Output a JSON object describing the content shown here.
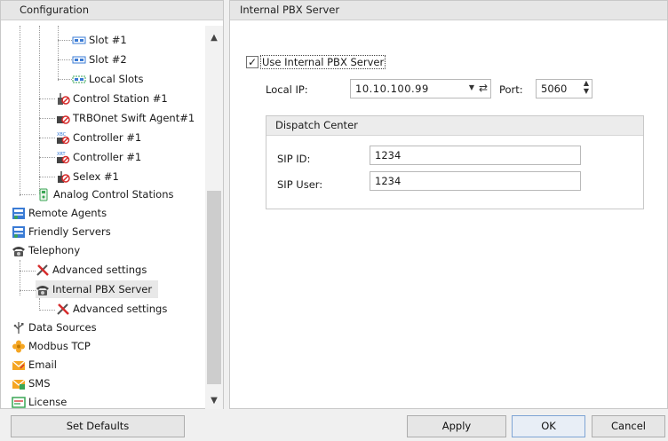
{
  "left_panel": {
    "header": "Configuration",
    "tree": {
      "slot1": "Slot #1",
      "slot2": "Slot #2",
      "local_slots": "Local Slots",
      "control_station": "Control Station #1",
      "trbonet_agent": "TRBOnet Swift Agent#1",
      "controller1": "Controller #1",
      "controller2": "Controller #1",
      "selex": "Selex #1",
      "analog_control": "Analog Control Stations",
      "remote_agents": "Remote Agents",
      "friendly_servers": "Friendly Servers",
      "telephony": "Telephony",
      "advanced_settings_1": "Advanced settings",
      "internal_pbx": "Internal PBX Server",
      "advanced_settings_2": "Advanced settings",
      "data_sources": "Data Sources",
      "modbus_tcp": "Modbus TCP",
      "email": "Email",
      "sms": "SMS",
      "license": "License"
    },
    "set_defaults": "Set Defaults"
  },
  "right_panel": {
    "header": "Internal PBX Server",
    "use_internal_pbx": {
      "label": "Use Internal PBX Server",
      "checked": true
    },
    "local_ip": {
      "label": "Local IP:",
      "value": "10.10.100.99"
    },
    "port": {
      "label": "Port:",
      "value": "5060"
    },
    "dispatch_center": {
      "title": "Dispatch Center",
      "sip_id": {
        "label": "SIP ID:",
        "value": "1234"
      },
      "sip_user": {
        "label": "SIP User:",
        "value": "1234"
      }
    }
  },
  "buttons": {
    "apply": "Apply",
    "ok": "OK",
    "cancel": "Cancel"
  },
  "icons": {
    "slot": "slot-icon",
    "local_slots": "local-slots-icon",
    "control_station": "control-station-icon",
    "agent": "agent-icon",
    "controller": "controller-icon",
    "selex": "selex-icon",
    "analog": "analog-station-icon",
    "remote_agents": "remote-agents-icon",
    "friendly_servers": "friendly-servers-icon",
    "telephony": "telephone-icon",
    "advanced": "tools-icon",
    "data_sources": "usb-icon",
    "modbus": "gear-flower-icon",
    "email": "email-icon",
    "sms": "sms-icon",
    "license": "license-icon"
  },
  "colors": {
    "selection_bg": "#e8e8e8",
    "ok_accent": "#7ea4d4",
    "icon_blue": "#3a7bd5",
    "icon_red": "#d62b2b",
    "icon_orange": "#f5a623",
    "icon_green": "#3aa655"
  }
}
